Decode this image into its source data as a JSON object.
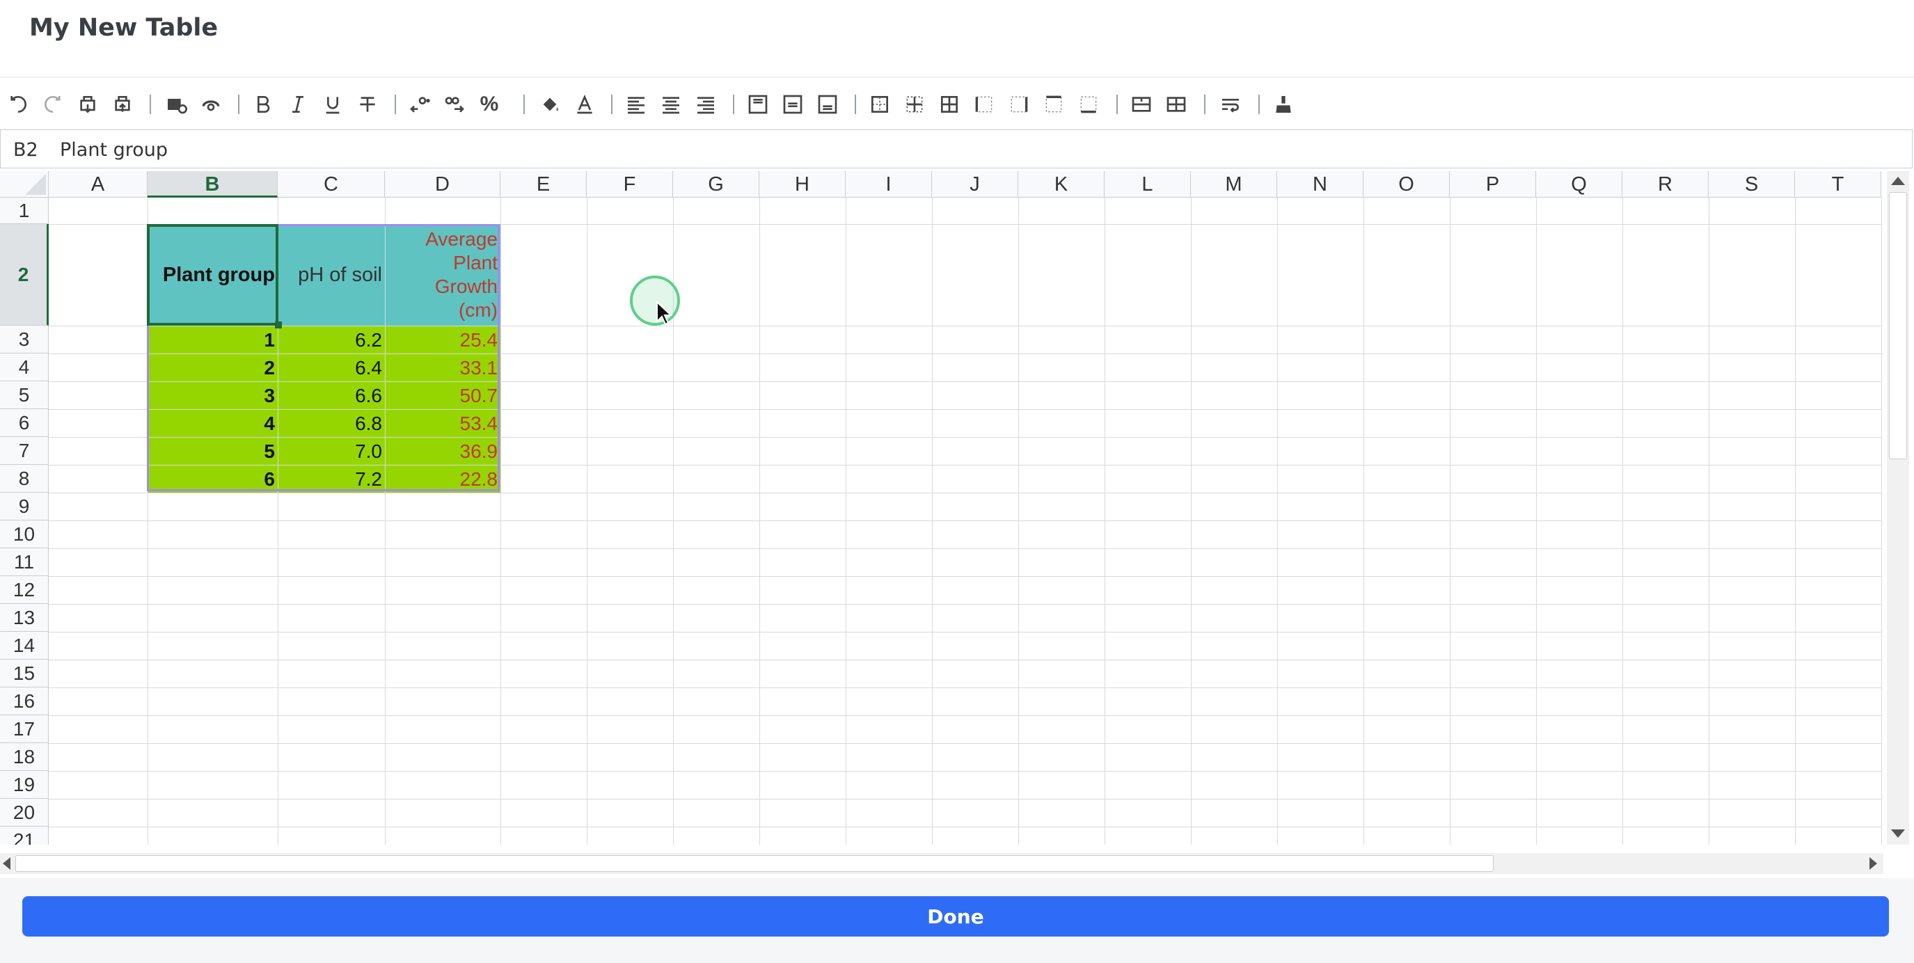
{
  "window": {
    "title": "My New Table"
  },
  "toolbar": {
    "icons": [
      "undo-icon",
      "redo-icon",
      "export-icon",
      "import-icon",
      "insert-image-icon",
      "link-icon",
      "bold-icon",
      "italic-icon",
      "underline-icon",
      "strikethrough-icon",
      "decrease-decimal-icon",
      "increase-decimal-icon",
      "percent-icon",
      "fill-color-icon",
      "text-color-icon",
      "align-left-icon",
      "align-center-icon",
      "align-right-icon",
      "valign-top-icon",
      "valign-middle-icon",
      "valign-bottom-icon",
      "borders-all-icon",
      "borders-inner-icon",
      "borders-grid-icon",
      "borders-left-icon",
      "borders-right-icon",
      "borders-top-icon",
      "borders-bottom-icon",
      "merge-cells-icon",
      "unmerge-cells-icon",
      "wrap-text-icon",
      "clear-format-icon"
    ],
    "percent_label": "%"
  },
  "formula_bar": {
    "cell_ref": "B2",
    "value": "Plant group"
  },
  "sheet": {
    "columns": [
      "A",
      "B",
      "C",
      "D",
      "E",
      "F",
      "G",
      "H",
      "I",
      "J",
      "K",
      "L",
      "M",
      "N",
      "O",
      "P",
      "Q",
      "R",
      "S",
      "T"
    ],
    "rows": [
      "1",
      "2",
      "3",
      "4",
      "5",
      "6",
      "7",
      "8",
      "9",
      "10",
      "11",
      "12",
      "13",
      "14",
      "15",
      "16",
      "17",
      "18",
      "19",
      "20",
      "21"
    ],
    "selected_column": "B",
    "selected_row": "2",
    "header_row": {
      "b": "Plant group",
      "c": "pH of soil",
      "d_lines": [
        "Average",
        "Plant",
        "Growth",
        "(cm)"
      ]
    },
    "data_rows": [
      {
        "b": "1",
        "c": "6.2",
        "d": "25.4"
      },
      {
        "b": "2",
        "c": "6.4",
        "d": "33.1"
      },
      {
        "b": "3",
        "c": "6.6",
        "d": "50.7"
      },
      {
        "b": "4",
        "c": "6.8",
        "d": "53.4"
      },
      {
        "b": "5",
        "c": "7.0",
        "d": "36.9"
      },
      {
        "b": "6",
        "c": "7.2",
        "d": "22.8"
      }
    ],
    "colors": {
      "header_fill": "#5fc3c1",
      "data_fill": "#96d600",
      "growth_text": "#c0392b",
      "selection": "#1e6b3a",
      "range_border": "#a58af0"
    }
  },
  "footer": {
    "done_label": "Done",
    "done_color": "#2f6cf6"
  }
}
